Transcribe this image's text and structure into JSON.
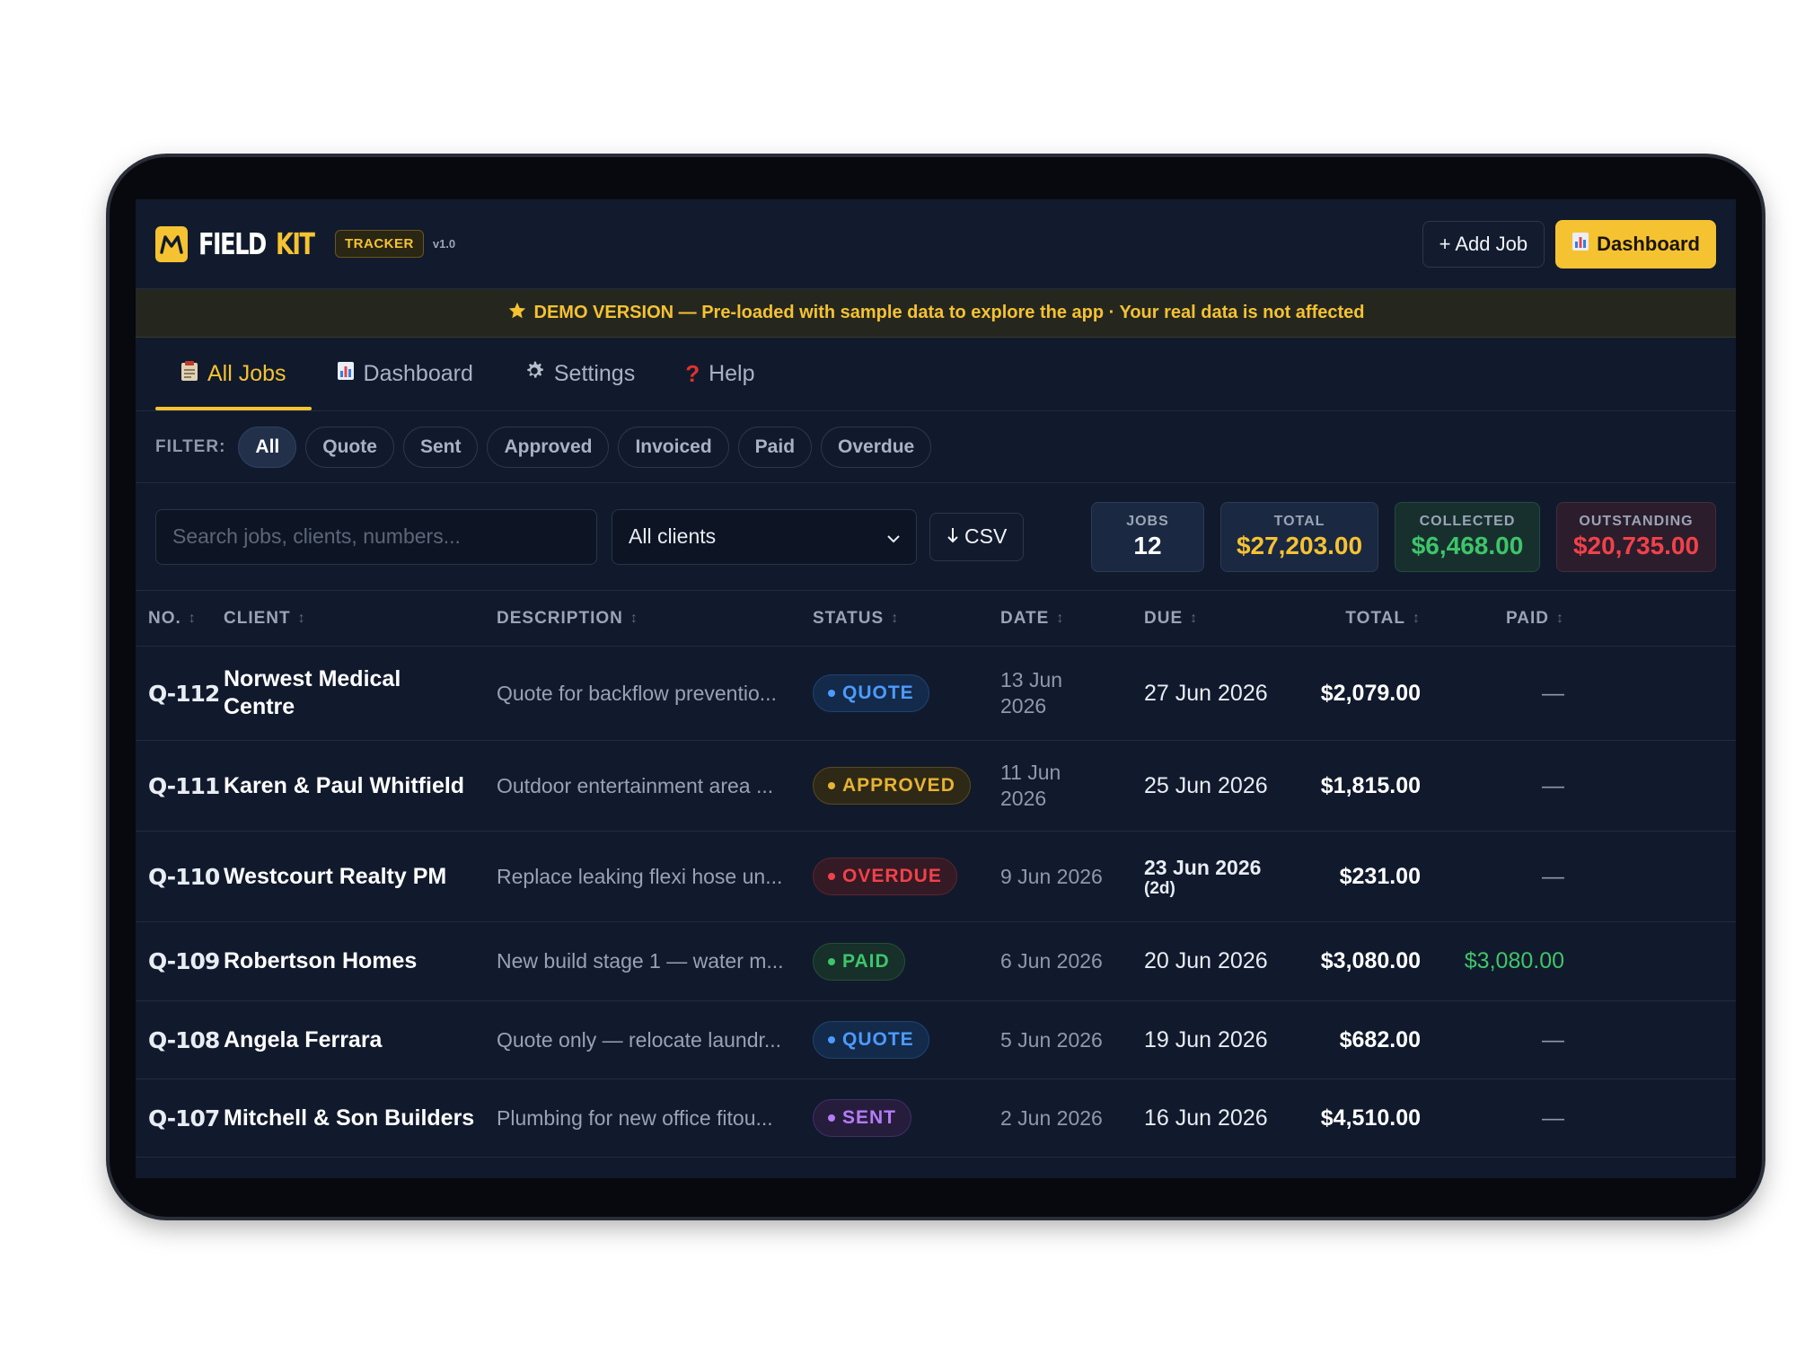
{
  "app": {
    "brand_word1": "FIELD",
    "brand_word2": "KIT",
    "badge": "TRACKER",
    "version": "v1.0"
  },
  "header": {
    "add_job_label": "+ Add Job",
    "dashboard_label": "Dashboard",
    "dashboard_icon": "bar-chart-icon"
  },
  "banner": {
    "icon": "star-icon",
    "text": "DEMO VERSION — Pre-loaded with sample data to explore the app · Your real data is not affected"
  },
  "tabs": [
    {
      "label": "All Jobs",
      "icon": "clipboard-icon",
      "active": true
    },
    {
      "label": "Dashboard",
      "icon": "bar-chart-icon",
      "active": false
    },
    {
      "label": "Settings",
      "icon": "gear-icon",
      "active": false
    },
    {
      "label": "Help",
      "icon": "question-icon",
      "active": false
    }
  ],
  "filters": {
    "label": "FILTER:",
    "options": [
      "All",
      "Quote",
      "Sent",
      "Approved",
      "Invoiced",
      "Paid",
      "Overdue"
    ],
    "active": "All"
  },
  "toolbar": {
    "search_placeholder": "Search jobs, clients, numbers...",
    "client_select": "All clients",
    "csv_label": "CSV"
  },
  "stats": {
    "jobs": {
      "label": "JOBS",
      "value": "12"
    },
    "total": {
      "label": "TOTAL",
      "value": "$27,203.00"
    },
    "collected": {
      "label": "COLLECTED",
      "value": "$6,468.00"
    },
    "outstanding": {
      "label": "OUTSTANDING",
      "value": "$20,735.00"
    }
  },
  "table": {
    "columns": [
      "NO.",
      "CLIENT",
      "DESCRIPTION",
      "STATUS",
      "DATE",
      "DUE",
      "TOTAL",
      "PAID"
    ],
    "rows": [
      {
        "no": "Q-112",
        "client": "Norwest Medical Centre",
        "description": "Quote for backflow preventio...",
        "status": "QUOTE",
        "date": "13 Jun 2026",
        "due": "27 Jun 2026",
        "due_note": "",
        "total": "$2,079.00",
        "paid": "—"
      },
      {
        "no": "Q-111",
        "client": "Karen & Paul Whitfield",
        "description": "Outdoor entertainment area ...",
        "status": "APPROVED",
        "date": "11 Jun 2026",
        "due": "25 Jun 2026",
        "due_note": "",
        "total": "$1,815.00",
        "paid": "—"
      },
      {
        "no": "Q-110",
        "client": "Westcourt Realty PM",
        "description": "Replace leaking flexi hose un...",
        "status": "OVERDUE",
        "date": "9 Jun 2026",
        "due": "23 Jun 2026",
        "due_note": "(2d)",
        "total": "$231.00",
        "paid": "—"
      },
      {
        "no": "Q-109",
        "client": "Robertson Homes",
        "description": "New build stage 1 — water m...",
        "status": "PAID",
        "date": "6 Jun 2026",
        "due": "20 Jun 2026",
        "due_note": "",
        "total": "$3,080.00",
        "paid": "$3,080.00"
      },
      {
        "no": "Q-108",
        "client": "Angela Ferrara",
        "description": "Quote only — relocate laundr...",
        "status": "QUOTE",
        "date": "5 Jun 2026",
        "due": "19 Jun 2026",
        "due_note": "",
        "total": "$682.00",
        "paid": "—"
      },
      {
        "no": "Q-107",
        "client": "Mitchell & Son Builders",
        "description": "Plumbing for new office fitou...",
        "status": "SENT",
        "date": "2 Jun 2026",
        "due": "16 Jun 2026",
        "due_note": "",
        "total": "$4,510.00",
        "paid": "—"
      }
    ]
  }
}
